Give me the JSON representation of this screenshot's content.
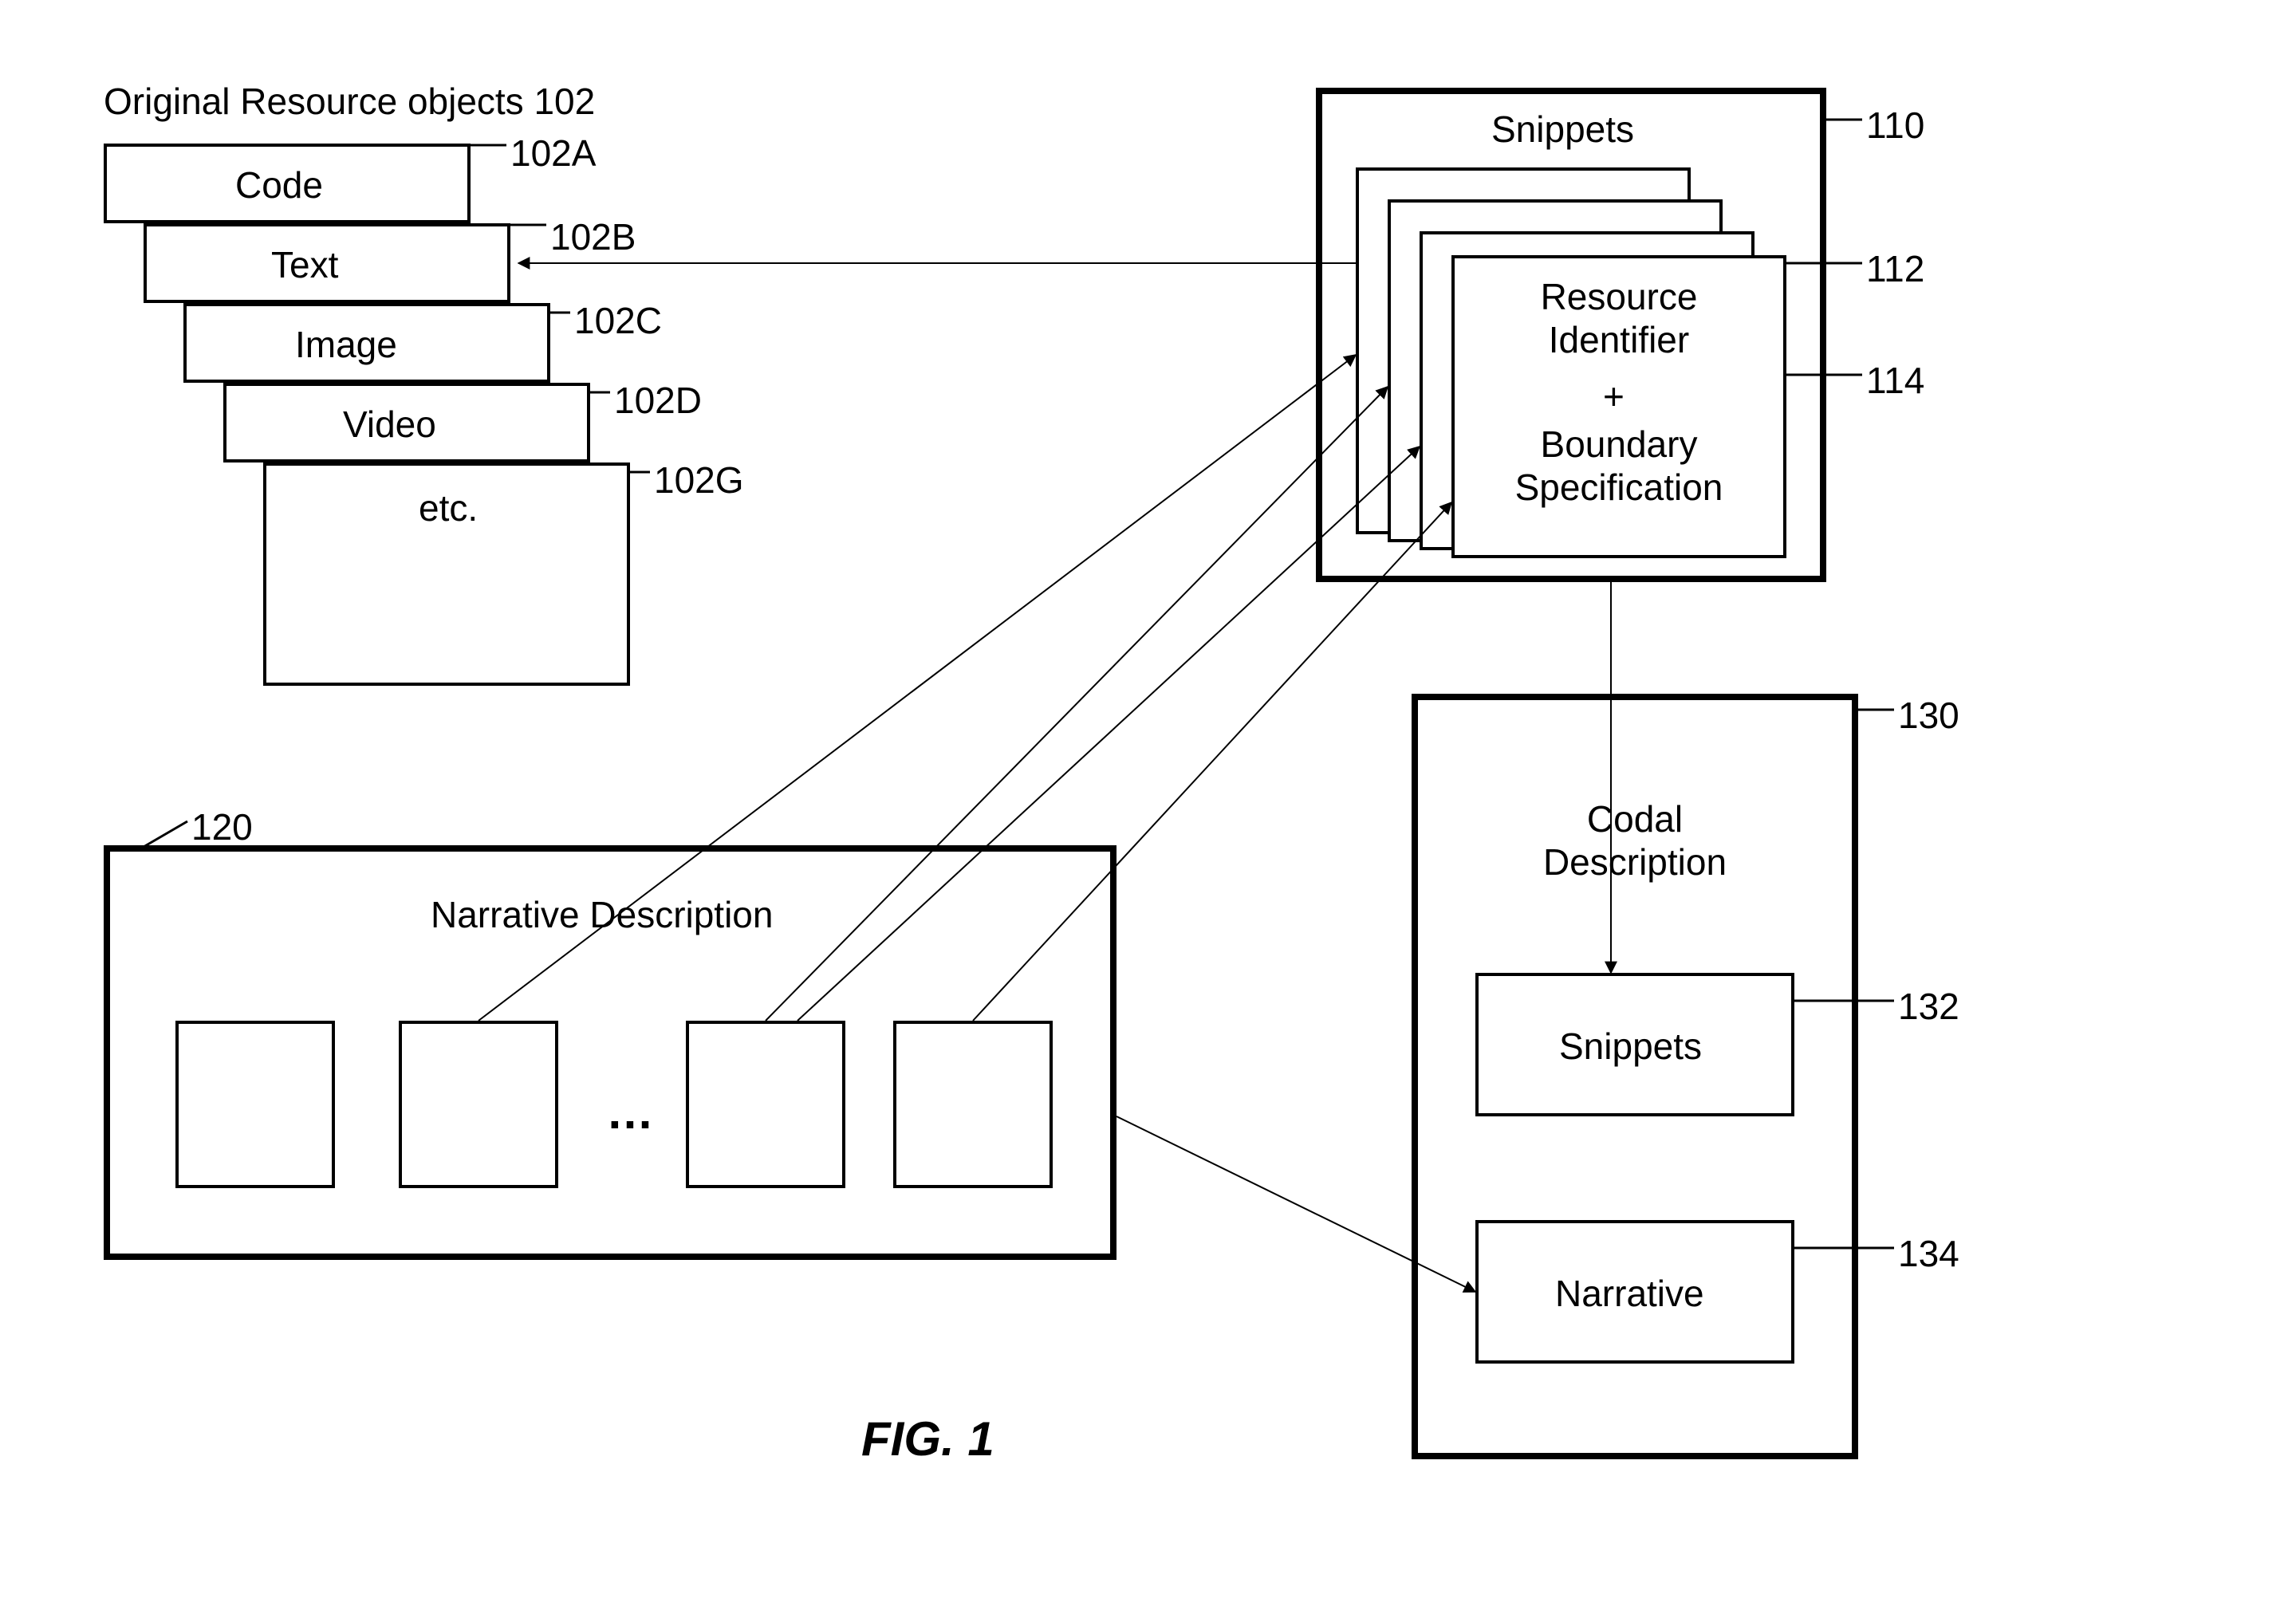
{
  "title_resources": "Original Resource objects 102",
  "resources": {
    "code": "Code",
    "text": "Text",
    "image": "Image",
    "video": "Video",
    "etc": "etc."
  },
  "res_refs": {
    "a": "102A",
    "b": "102B",
    "c": "102C",
    "d": "102D",
    "g": "102G"
  },
  "snippets": {
    "title": "Snippets",
    "resource_identifier": "Resource\nIdentifier",
    "plus": "+",
    "boundary": "Boundary\nSpecification"
  },
  "snip_refs": {
    "outer": "110",
    "ri": "112",
    "bs": "114"
  },
  "narrative": {
    "title": "Narrative Description",
    "ellipsis": "…",
    "ref": "120"
  },
  "codal": {
    "title": "Codal\nDescription",
    "snippets": "Snippets",
    "narrative": "Narrative",
    "ref_outer": "130",
    "ref_snip": "132",
    "ref_narr": "134"
  },
  "figure": "FIG. 1"
}
